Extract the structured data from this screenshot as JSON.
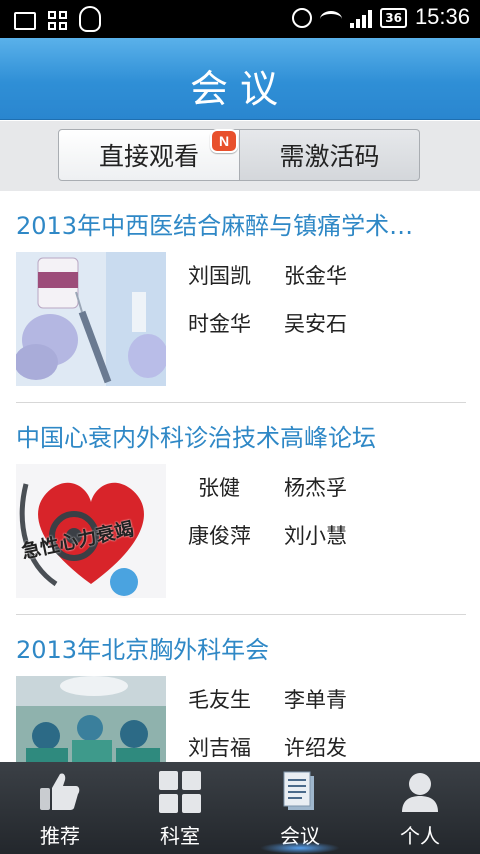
{
  "status_bar": {
    "time": "15:36",
    "battery": "36"
  },
  "header": {
    "title": "会议"
  },
  "tabs": [
    {
      "label": "直接观看",
      "badge": "N",
      "selected": true
    },
    {
      "label": "需激活码",
      "selected": false
    }
  ],
  "conferences": [
    {
      "title": "2013年中西医结合麻醉与镇痛学术…",
      "speakers": [
        "刘国凯",
        "张金华",
        "时金华",
        "吴安石"
      ]
    },
    {
      "title": "中国心衰内外科诊治技术高峰论坛",
      "speakers": [
        "张健",
        "杨杰孚",
        "康俊萍",
        "刘小慧"
      ],
      "thumb_text": "急性心力衰竭"
    },
    {
      "title": "2013年北京胸外科年会",
      "speakers": [
        "毛友生",
        "李单青",
        "刘吉福",
        "许绍发"
      ]
    }
  ],
  "bottom_nav": [
    {
      "label": "推荐",
      "icon": "thumbs-up-icon"
    },
    {
      "label": "科室",
      "icon": "grid-icon"
    },
    {
      "label": "会议",
      "icon": "document-icon",
      "active": true
    },
    {
      "label": "个人",
      "icon": "person-icon"
    }
  ],
  "colors": {
    "accent": "#2f8fd6",
    "title_link": "#2f88c6",
    "badge": "#e8502c"
  }
}
